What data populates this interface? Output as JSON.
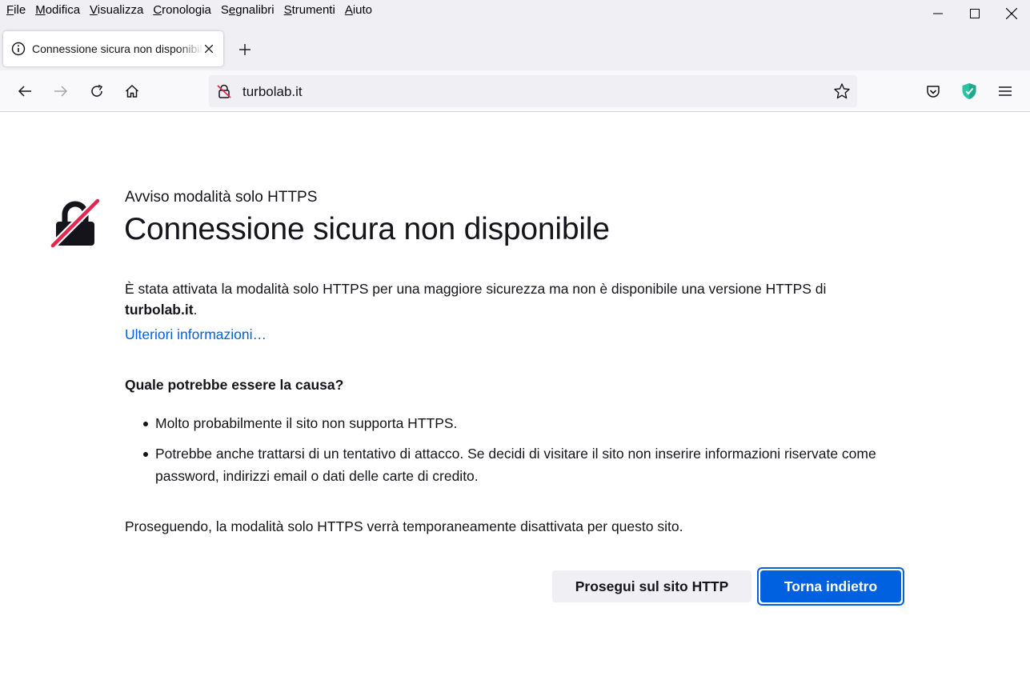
{
  "menubar": {
    "items": [
      {
        "pre": "",
        "key": "F",
        "post": "ile"
      },
      {
        "pre": "",
        "key": "M",
        "post": "odifica"
      },
      {
        "pre": "",
        "key": "V",
        "post": "isualizza"
      },
      {
        "pre": "",
        "key": "C",
        "post": "ronologia"
      },
      {
        "pre": "S",
        "key": "e",
        "post": "gnalibri"
      },
      {
        "pre": "",
        "key": "S",
        "post": "trumenti"
      },
      {
        "pre": "",
        "key": "A",
        "post": "iuto"
      }
    ]
  },
  "tab": {
    "title": "Connessione sicura non disponibile"
  },
  "urlbar": {
    "url": "turbolab.it"
  },
  "page": {
    "subtitle": "Avviso modalità solo HTTPS",
    "title": "Connessione sicura non disponibile",
    "description_prefix": "È stata attivata la modalità solo HTTPS per una maggiore sicurezza ma non è disponibile una versione HTTPS di ",
    "description_site": "turbolab.it",
    "description_suffix": ".",
    "learn_more": "Ulteriori informazioni…",
    "cause_heading": "Quale potrebbe essere la causa?",
    "causes": [
      "Molto probabilmente il sito non supporta HTTPS.",
      "Potrebbe anche trattarsi di un tentativo di attacco. Se decidi di visitare il sito non inserire informazioni riservate come password, indirizzi email o dati delle carte di credito."
    ],
    "proceed_note": "Proseguendo, la modalità solo HTTPS verrà temporaneamente disattivata per questo sito.",
    "btn_continue": "Prosegui sul sito HTTP",
    "btn_back": "Torna indietro"
  },
  "colors": {
    "accent": "#0061e0",
    "warning_red": "#e22850",
    "shield_green": "#2ac3a2"
  }
}
